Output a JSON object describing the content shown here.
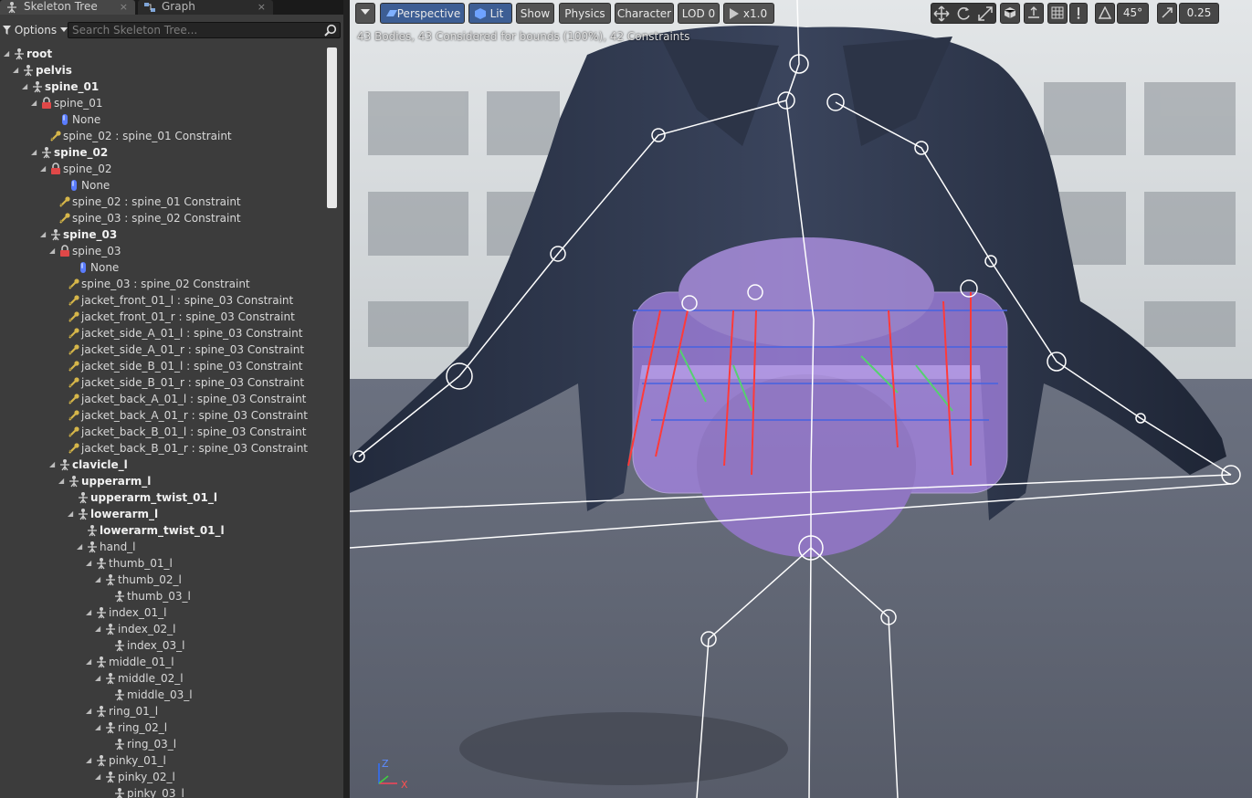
{
  "tabs": [
    {
      "label": "Skeleton Tree",
      "close": "×"
    },
    {
      "label": "Graph",
      "close": "×"
    }
  ],
  "options_label": "Options",
  "search_placeholder": "Search Skeleton Tree...",
  "tree": [
    {
      "label": "root",
      "type": "bone",
      "level": 0,
      "bold": true,
      "exp": true
    },
    {
      "label": "pelvis",
      "type": "bone",
      "level": 1,
      "bold": true,
      "exp": true
    },
    {
      "label": "spine_01",
      "type": "bone",
      "level": 2,
      "bold": true,
      "exp": true
    },
    {
      "label": "spine_01",
      "type": "body",
      "level": 3,
      "bold": false,
      "exp": true
    },
    {
      "label": "None",
      "type": "shape",
      "level": 5,
      "bold": false,
      "exp": false
    },
    {
      "label": "spine_02 : spine_01 Constraint",
      "type": "constraint",
      "level": 4,
      "bold": false,
      "exp": false
    },
    {
      "label": "spine_02",
      "type": "bone",
      "level": 3,
      "bold": true,
      "exp": true
    },
    {
      "label": "spine_02",
      "type": "body",
      "level": 4,
      "bold": false,
      "exp": true
    },
    {
      "label": "None",
      "type": "shape",
      "level": 6,
      "bold": false,
      "exp": false
    },
    {
      "label": "spine_02 : spine_01 Constraint",
      "type": "constraint",
      "level": 5,
      "bold": false,
      "exp": false
    },
    {
      "label": "spine_03 : spine_02 Constraint",
      "type": "constraint",
      "level": 5,
      "bold": false,
      "exp": false
    },
    {
      "label": "spine_03",
      "type": "bone",
      "level": 4,
      "bold": true,
      "exp": true
    },
    {
      "label": "spine_03",
      "type": "body",
      "level": 5,
      "bold": false,
      "exp": true
    },
    {
      "label": "None",
      "type": "shape",
      "level": 7,
      "bold": false,
      "exp": false
    },
    {
      "label": "spine_03 : spine_02 Constraint",
      "type": "constraint",
      "level": 6,
      "bold": false,
      "exp": false
    },
    {
      "label": "jacket_front_01_l : spine_03 Constraint",
      "type": "constraint",
      "level": 6,
      "bold": false,
      "exp": false
    },
    {
      "label": "jacket_front_01_r : spine_03 Constraint",
      "type": "constraint",
      "level": 6,
      "bold": false,
      "exp": false
    },
    {
      "label": "jacket_side_A_01_l : spine_03 Constraint",
      "type": "constraint",
      "level": 6,
      "bold": false,
      "exp": false
    },
    {
      "label": "jacket_side_A_01_r : spine_03 Constraint",
      "type": "constraint",
      "level": 6,
      "bold": false,
      "exp": false
    },
    {
      "label": "jacket_side_B_01_l : spine_03 Constraint",
      "type": "constraint",
      "level": 6,
      "bold": false,
      "exp": false
    },
    {
      "label": "jacket_side_B_01_r : spine_03 Constraint",
      "type": "constraint",
      "level": 6,
      "bold": false,
      "exp": false
    },
    {
      "label": "jacket_back_A_01_l : spine_03 Constraint",
      "type": "constraint",
      "level": 6,
      "bold": false,
      "exp": false
    },
    {
      "label": "jacket_back_A_01_r : spine_03 Constraint",
      "type": "constraint",
      "level": 6,
      "bold": false,
      "exp": false
    },
    {
      "label": "jacket_back_B_01_l : spine_03 Constraint",
      "type": "constraint",
      "level": 6,
      "bold": false,
      "exp": false
    },
    {
      "label": "jacket_back_B_01_r : spine_03 Constraint",
      "type": "constraint",
      "level": 6,
      "bold": false,
      "exp": false
    },
    {
      "label": "clavicle_l",
      "type": "bone",
      "level": 5,
      "bold": true,
      "exp": true
    },
    {
      "label": "upperarm_l",
      "type": "bone",
      "level": 6,
      "bold": true,
      "exp": true
    },
    {
      "label": "upperarm_twist_01_l",
      "type": "bone",
      "level": 7,
      "bold": true,
      "exp": false
    },
    {
      "label": "lowerarm_l",
      "type": "bone",
      "level": 7,
      "bold": true,
      "exp": true
    },
    {
      "label": "lowerarm_twist_01_l",
      "type": "bone",
      "level": 8,
      "bold": true,
      "exp": false
    },
    {
      "label": "hand_l",
      "type": "bone",
      "level": 8,
      "bold": false,
      "exp": true
    },
    {
      "label": "thumb_01_l",
      "type": "bone",
      "level": 9,
      "bold": false,
      "exp": true
    },
    {
      "label": "thumb_02_l",
      "type": "bone",
      "level": 10,
      "bold": false,
      "exp": true
    },
    {
      "label": "thumb_03_l",
      "type": "bone",
      "level": 11,
      "bold": false,
      "exp": false
    },
    {
      "label": "index_01_l",
      "type": "bone",
      "level": 9,
      "bold": false,
      "exp": true
    },
    {
      "label": "index_02_l",
      "type": "bone",
      "level": 10,
      "bold": false,
      "exp": true
    },
    {
      "label": "index_03_l",
      "type": "bone",
      "level": 11,
      "bold": false,
      "exp": false
    },
    {
      "label": "middle_01_l",
      "type": "bone",
      "level": 9,
      "bold": false,
      "exp": true
    },
    {
      "label": "middle_02_l",
      "type": "bone",
      "level": 10,
      "bold": false,
      "exp": true
    },
    {
      "label": "middle_03_l",
      "type": "bone",
      "level": 11,
      "bold": false,
      "exp": false
    },
    {
      "label": "ring_01_l",
      "type": "bone",
      "level": 9,
      "bold": false,
      "exp": true
    },
    {
      "label": "ring_02_l",
      "type": "bone",
      "level": 10,
      "bold": false,
      "exp": true
    },
    {
      "label": "ring_03_l",
      "type": "bone",
      "level": 11,
      "bold": false,
      "exp": false
    },
    {
      "label": "pinky_01_l",
      "type": "bone",
      "level": 9,
      "bold": false,
      "exp": true
    },
    {
      "label": "pinky_02_l",
      "type": "bone",
      "level": 10,
      "bold": false,
      "exp": true
    },
    {
      "label": "pinky_03_l",
      "type": "bone",
      "level": 11,
      "bold": false,
      "exp": false
    }
  ],
  "viewport": {
    "toolbar": {
      "perspective": "Perspective",
      "lit": "Lit",
      "show": "Show",
      "physics": "Physics",
      "character": "Character",
      "lod": "LOD 0",
      "speed": "x1.0"
    },
    "stats": "43 Bodies, 43 Considered for bounds (100%), 42 Constraints",
    "angle": "45°",
    "scale": "0.25",
    "axis_z": "Z",
    "axis_x": "X"
  },
  "colors": {
    "physics_body": "#a784e6",
    "selected_tool": "#3d5e94",
    "panel_bg": "#3c3c3c"
  }
}
